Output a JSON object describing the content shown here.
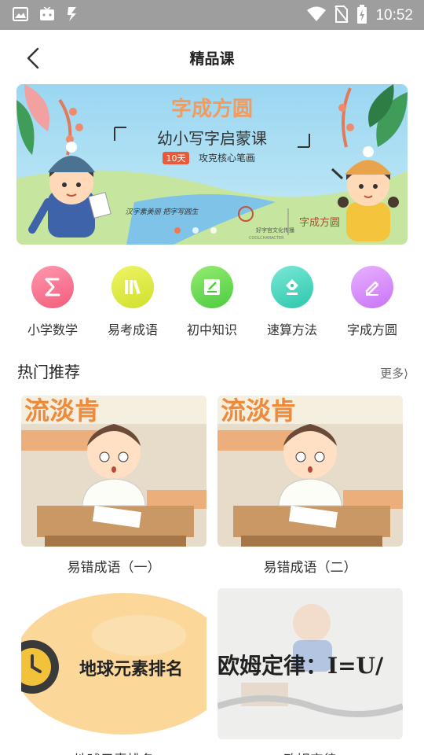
{
  "statusbar": {
    "time": "10:52"
  },
  "header": {
    "title": "精品课"
  },
  "banner": {
    "title": "字成方圆",
    "subtitle": "幼小写字启蒙课",
    "badge": "10天",
    "tagline": "攻克核心笔画",
    "caption": "汉字素美丽 把字写圆生",
    "brand": "字成方圆",
    "partner": "好字宫文化传播",
    "partner_en": "COOLCHARACTER"
  },
  "categories": [
    {
      "label": "小学数学",
      "color_a": "#ff8aa5",
      "color_b": "#f25d7c",
      "icon": "sigma-icon"
    },
    {
      "label": "易考成语",
      "color_a": "#e6f25a",
      "color_b": "#cfe02c",
      "icon": "books-icon"
    },
    {
      "label": "初中知识",
      "color_a": "#8ee86a",
      "color_b": "#4ccb3f",
      "icon": "notepad-icon"
    },
    {
      "label": "速算方法",
      "color_a": "#6fe3d0",
      "color_b": "#2cc7ad",
      "icon": "pen-nib-icon"
    },
    {
      "label": "字成方圆",
      "color_a": "#e3a6ff",
      "color_b": "#c974f5",
      "icon": "pencil-icon"
    }
  ],
  "section": {
    "title": "热门推荐",
    "more": "更多⟩"
  },
  "courses": [
    {
      "title": "易错成语（一）",
      "thumb_text": "流淡肯"
    },
    {
      "title": "易错成语（二）",
      "thumb_text": "流淡肯"
    },
    {
      "title": "地球元素排名",
      "thumb_text": "地球元素排名"
    },
    {
      "title": "欧姆定律",
      "thumb_text": "欧姆定律：I=U/"
    }
  ]
}
